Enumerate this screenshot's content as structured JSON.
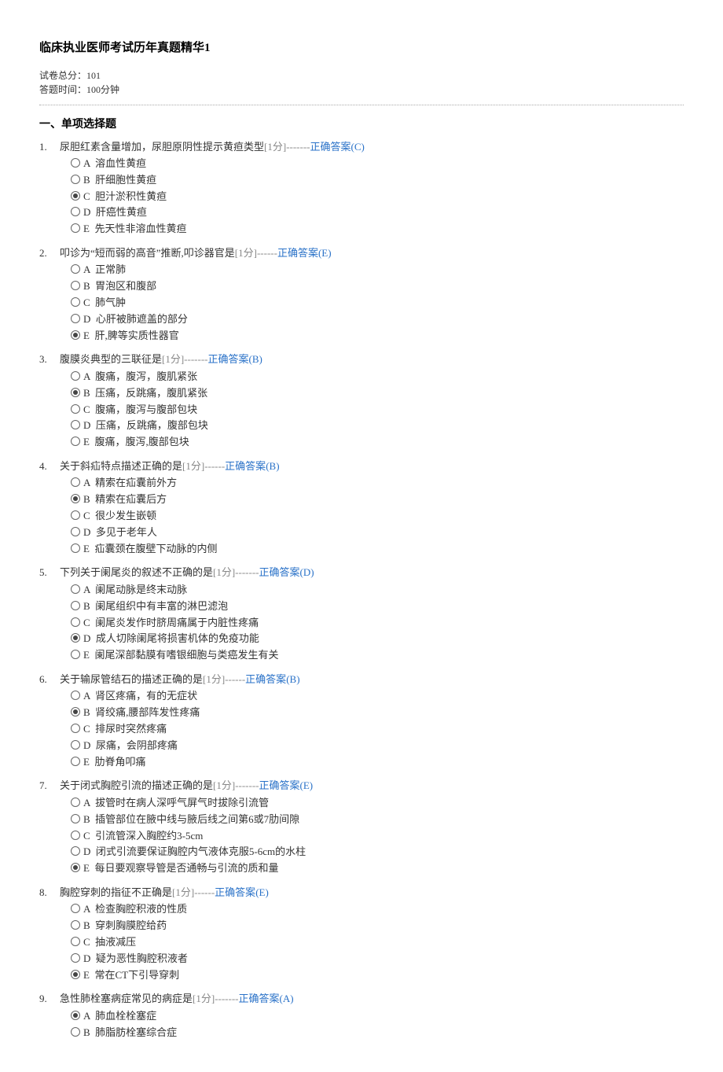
{
  "title": "临床执业医师考试历年真题精华1",
  "meta": {
    "total_label": "试卷总分：",
    "total_value": "101",
    "time_label": "答题时间：",
    "time_value": "100分钟"
  },
  "section_head": "一、单项选择题",
  "score_label": "[1分]",
  "answer_prefix": "正确答案",
  "questions": [
    {
      "num": "1.",
      "stem": "尿胆红素含量增加，尿胆原阴性提示黄疸类型",
      "dash": "-------",
      "answer": "(C)",
      "options": [
        {
          "l": "A",
          "t": "溶血性黄疸",
          "c": false
        },
        {
          "l": "B",
          "t": "肝细胞性黄疸",
          "c": false
        },
        {
          "l": "C",
          "t": "胆汁淤积性黄疸",
          "c": true
        },
        {
          "l": "D",
          "t": "肝癌性黄疸",
          "c": false
        },
        {
          "l": "E",
          "t": "先天性非溶血性黄疸",
          "c": false
        }
      ]
    },
    {
      "num": "2.",
      "stem": "叩诊为“短而弱的高音”推断,叩诊器官是",
      "dash": "------",
      "answer": "(E)",
      "options": [
        {
          "l": "A",
          "t": "正常肺",
          "c": false
        },
        {
          "l": "B",
          "t": "胃泡区和腹部",
          "c": false
        },
        {
          "l": "C",
          "t": "肺气肿",
          "c": false
        },
        {
          "l": "D",
          "t": "心肝被肺遮盖的部分",
          "c": false
        },
        {
          "l": "E",
          "t": "肝,脾等实质性器官",
          "c": true
        }
      ]
    },
    {
      "num": "3.",
      "stem": "腹膜炎典型的三联征是",
      "dash": "-------",
      "answer": "(B)",
      "options": [
        {
          "l": "A",
          "t": "腹痛，腹泻，腹肌紧张",
          "c": false
        },
        {
          "l": "B",
          "t": "压痛，反跳痛，腹肌紧张",
          "c": true
        },
        {
          "l": "C",
          "t": "腹痛，腹泻与腹部包块",
          "c": false
        },
        {
          "l": "D",
          "t": "压痛，反跳痛，腹部包块",
          "c": false
        },
        {
          "l": "E",
          "t": "腹痛，腹泻,腹部包块",
          "c": false
        }
      ]
    },
    {
      "num": "4.",
      "stem": "关于斜疝特点描述正确的是",
      "dash": "------",
      "answer": "(B)",
      "options": [
        {
          "l": "A",
          "t": "精索在疝囊前外方",
          "c": false
        },
        {
          "l": "B",
          "t": "精索在疝囊后方",
          "c": true
        },
        {
          "l": "C",
          "t": "很少发生嵌顿",
          "c": false
        },
        {
          "l": "D",
          "t": "多见于老年人",
          "c": false
        },
        {
          "l": "E",
          "t": "疝囊颈在腹壁下动脉的内侧",
          "c": false
        }
      ]
    },
    {
      "num": "5.",
      "stem": "下列关于阑尾炎的叙述不正确的是",
      "dash": "-------",
      "answer": "(D)",
      "options": [
        {
          "l": "A",
          "t": "阑尾动脉是终末动脉",
          "c": false
        },
        {
          "l": "B",
          "t": "阑尾组织中有丰富的淋巴滤泡",
          "c": false
        },
        {
          "l": "C",
          "t": "阑尾炎发作时脐周痛属于内脏性疼痛",
          "c": false
        },
        {
          "l": "D",
          "t": "成人切除阑尾将损害机体的免疫功能",
          "c": true
        },
        {
          "l": "E",
          "t": "阑尾深部黏膜有嗜银细胞与类癌发生有关",
          "c": false
        }
      ]
    },
    {
      "num": "6.",
      "stem": "关于输尿管结石的描述正确的是",
      "dash": "------",
      "answer": "(B)",
      "options": [
        {
          "l": "A",
          "t": "肾区疼痛，有的无症状",
          "c": false
        },
        {
          "l": "B",
          "t": "肾绞痛,腰部阵发性疼痛",
          "c": true
        },
        {
          "l": "C",
          "t": "排尿时突然疼痛",
          "c": false
        },
        {
          "l": "D",
          "t": "尿痛，会阴部疼痛",
          "c": false
        },
        {
          "l": "E",
          "t": "肋脊角叩痛",
          "c": false
        }
      ]
    },
    {
      "num": "7.",
      "stem": "关于闭式胸腔引流的描述正确的是",
      "dash": "-------",
      "answer": "(E)",
      "options": [
        {
          "l": "A",
          "t": "拔管时在病人深呼气屏气时拔除引流管",
          "c": false
        },
        {
          "l": "B",
          "t": "插管部位在腋中线与腋后线之间第6或7肋间隙",
          "c": false
        },
        {
          "l": "C",
          "t": "引流管深入胸腔约3-5cm",
          "c": false
        },
        {
          "l": "D",
          "t": "闭式引流要保证胸腔内气液体克服5-6cm的水柱",
          "c": false
        },
        {
          "l": "E",
          "t": "每日要观察导管是否通畅与引流的质和量",
          "c": true
        }
      ]
    },
    {
      "num": "8.",
      "stem": "胸腔穿刺的指征不正确是",
      "dash": "------",
      "answer": "(E)",
      "options": [
        {
          "l": "A",
          "t": "检查胸腔积液的性质",
          "c": false
        },
        {
          "l": "B",
          "t": "穿刺胸膜腔给药",
          "c": false
        },
        {
          "l": "C",
          "t": "抽液减压",
          "c": false
        },
        {
          "l": "D",
          "t": "疑为恶性胸腔积液者",
          "c": false
        },
        {
          "l": "E",
          "t": "常在CT下引导穿刺",
          "c": true
        }
      ]
    },
    {
      "num": "9.",
      "stem": "急性肺栓塞病症常见的病症是",
      "dash": "-------",
      "answer": "(A)",
      "options": [
        {
          "l": "A",
          "t": "肺血栓栓塞症",
          "c": true
        },
        {
          "l": "B",
          "t": "肺脂肪栓塞综合症",
          "c": false
        }
      ]
    }
  ]
}
